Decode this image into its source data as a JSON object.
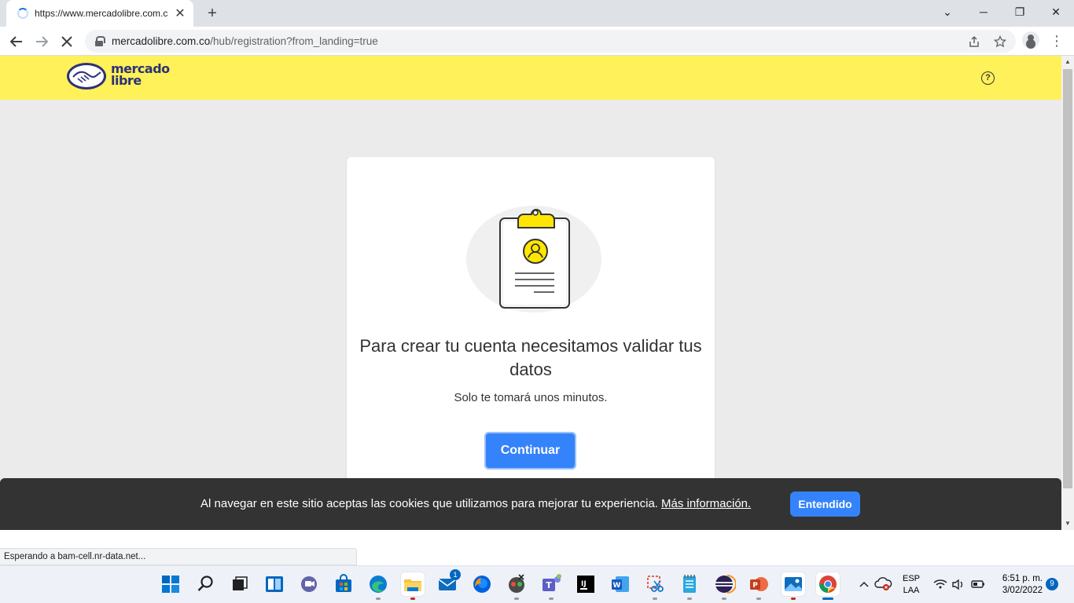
{
  "browser": {
    "tab_title": "https://www.mercadolibre.com.co",
    "tab_close": "✕",
    "new_tab": "+",
    "url_host": "mercadolibre.com.co",
    "url_path": "/hub/registration?from_landing=true",
    "window_controls": [
      "⌄",
      "─",
      "❐",
      "✕"
    ],
    "status_text": "Esperando a bam-cell.nr-data.net..."
  },
  "site": {
    "logo_line1": "mercado",
    "logo_line2": "libre",
    "help_symbol": "?",
    "brand_colors": {
      "yellow": "#fff159",
      "blue": "#3483fa",
      "navy": "#2d3277"
    }
  },
  "card": {
    "headline": "Para crear tu cuenta necesitamos validar tus datos",
    "subtext": "Solo te tomará unos minutos.",
    "continue_label": "Continuar"
  },
  "cookie_banner": {
    "text": "Al navegar en este sitio aceptas las cookies que utilizamos para mejorar tu experiencia.",
    "more_link": "Más información.",
    "accept_label": "Entendido"
  },
  "taskbar": {
    "apps": [
      {
        "name": "start-icon"
      },
      {
        "name": "search-icon"
      },
      {
        "name": "task-view-icon"
      },
      {
        "name": "widgets-icon"
      },
      {
        "name": "teams-chat-icon"
      },
      {
        "name": "store-icon"
      },
      {
        "name": "edge-icon"
      },
      {
        "name": "file-explorer-icon"
      },
      {
        "name": "mail-icon",
        "badge": "1"
      },
      {
        "name": "firefox-icon"
      },
      {
        "name": "git-icon"
      },
      {
        "name": "teams-icon"
      },
      {
        "name": "intellij-icon"
      },
      {
        "name": "word-icon"
      },
      {
        "name": "snipping-tool-icon"
      },
      {
        "name": "notepad-icon"
      },
      {
        "name": "eclipse-icon"
      },
      {
        "name": "powerpoint-icon"
      },
      {
        "name": "photos-icon"
      },
      {
        "name": "chrome-icon"
      }
    ],
    "lang_line1": "ESP",
    "lang_line2": "LAA",
    "time": "6:51 p. m.",
    "date": "3/02/2022",
    "notifications": "9"
  }
}
